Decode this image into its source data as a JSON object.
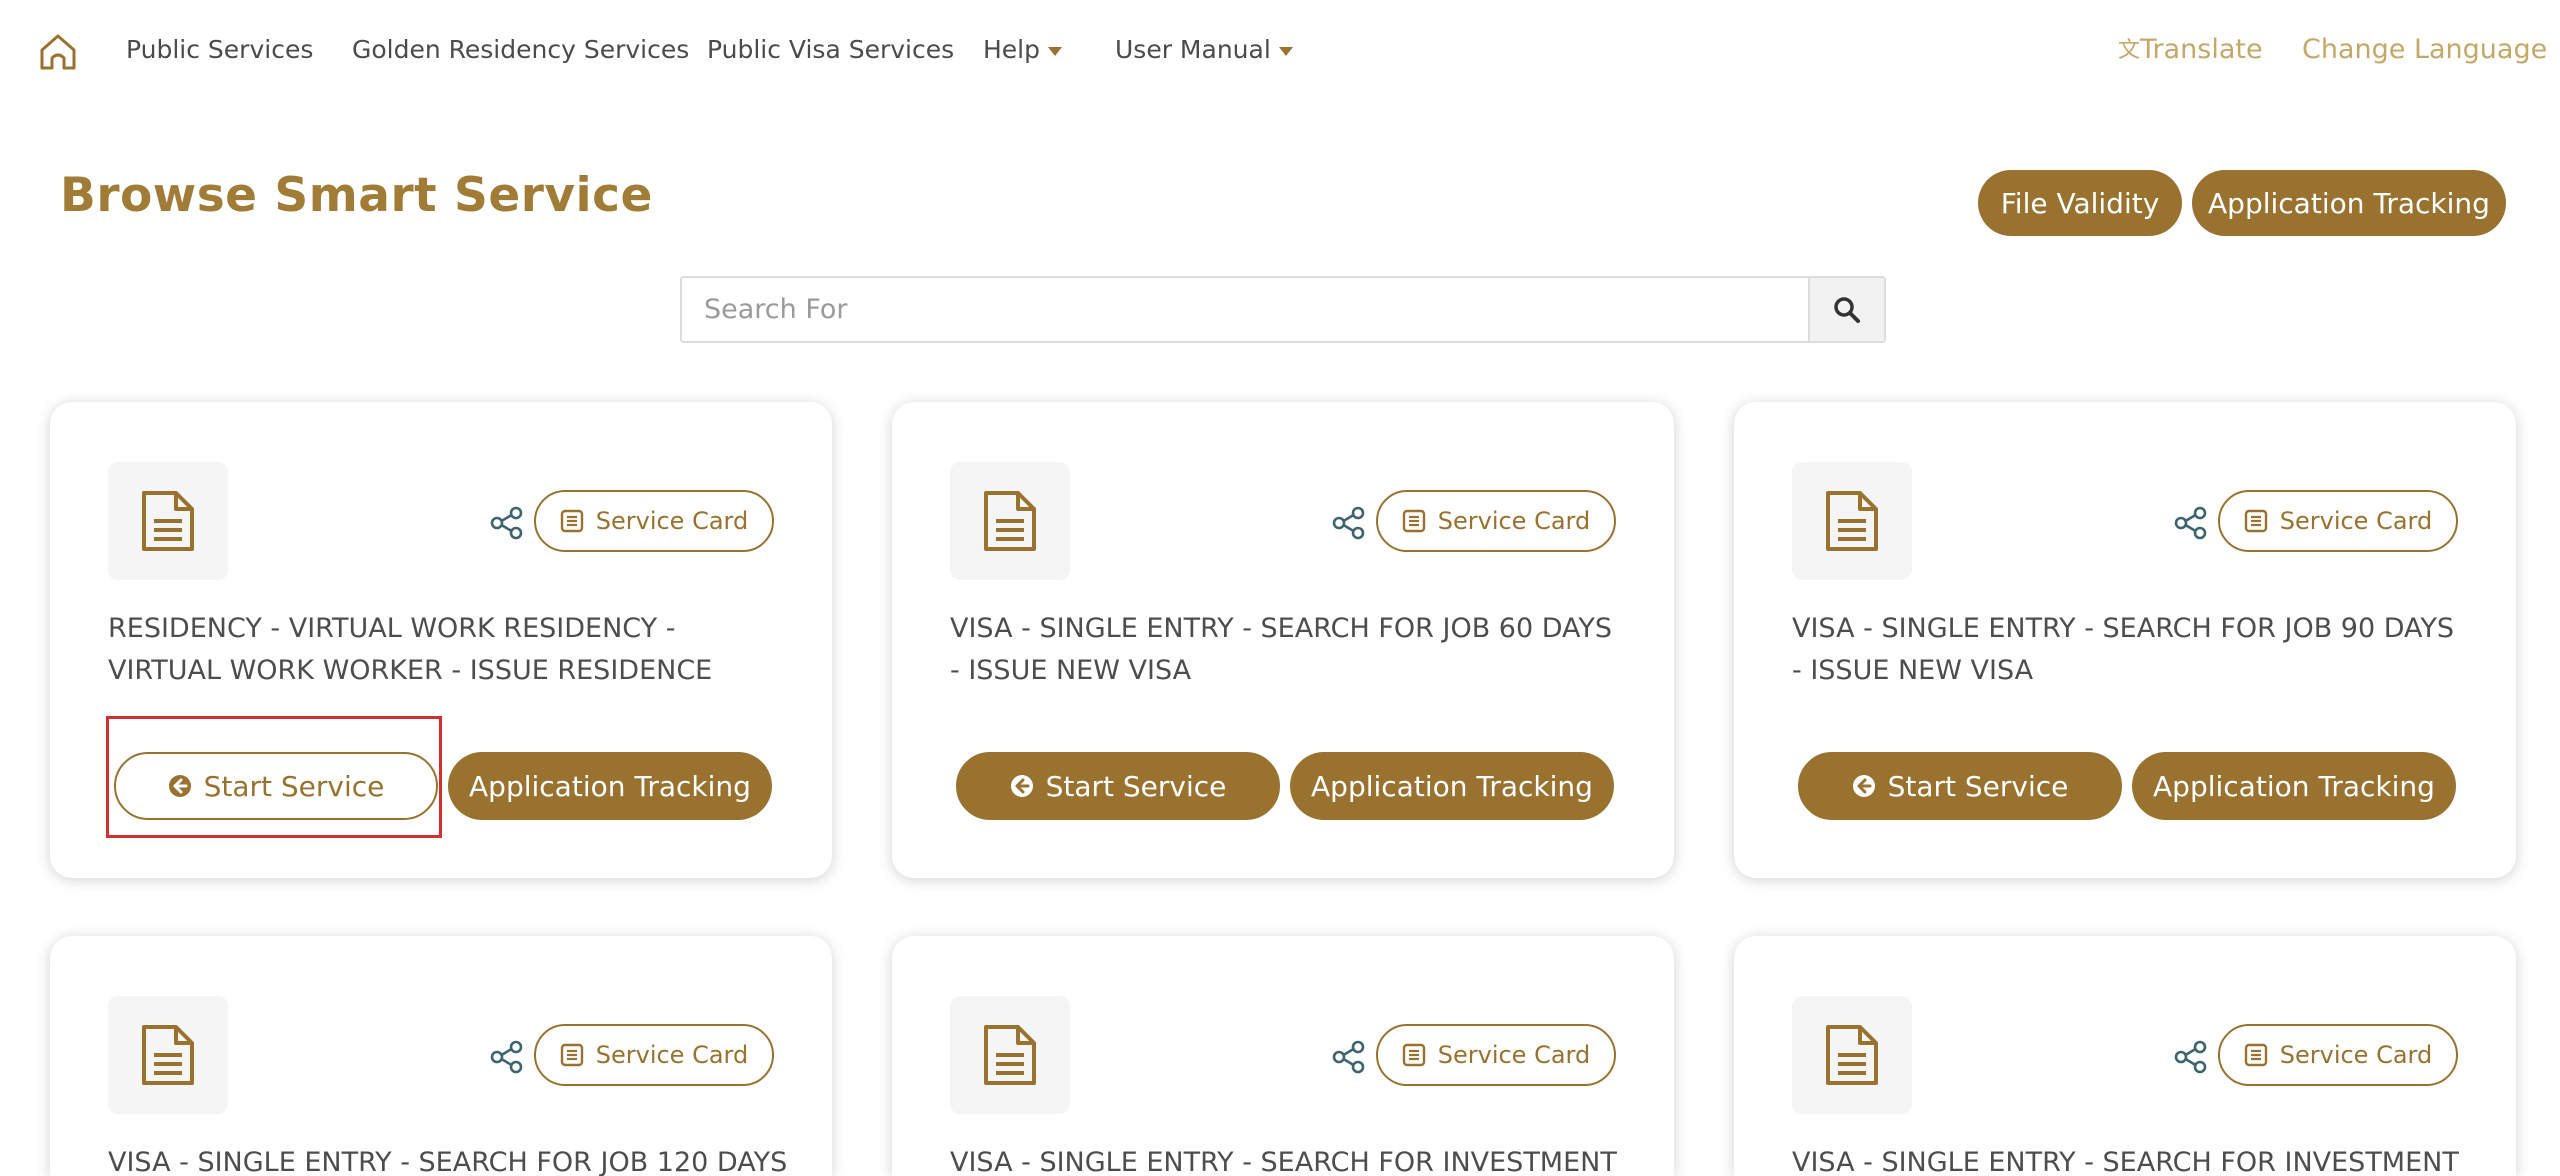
{
  "nav": {
    "items": [
      "Public Services",
      "Golden Residency Services",
      "Public Visa Services",
      "Help",
      "User Manual"
    ],
    "translate": "Translate",
    "change_language": "Change Language"
  },
  "header": {
    "title": "Browse Smart Service",
    "file_validity": "File Validity",
    "application_tracking": "Application Tracking"
  },
  "search": {
    "placeholder": "Search For"
  },
  "card_labels": {
    "service_card": "Service Card",
    "start_service": "Start Service",
    "application_tracking": "Application Tracking"
  },
  "cards": [
    {
      "title": "RESIDENCY - VIRTUAL WORK RESIDENCY - VIRTUAL WORK WORKER - ISSUE RESIDENCE"
    },
    {
      "title": "VISA - SINGLE ENTRY - SEARCH FOR JOB 60 DAYS - ISSUE NEW VISA"
    },
    {
      "title": "VISA - SINGLE ENTRY - SEARCH FOR JOB 90 DAYS - ISSUE NEW VISA"
    },
    {
      "title": "VISA - SINGLE ENTRY - SEARCH FOR JOB 120 DAYS -"
    },
    {
      "title": "VISA - SINGLE ENTRY - SEARCH FOR INVESTMENT"
    },
    {
      "title": "VISA - SINGLE ENTRY - SEARCH FOR INVESTMENT"
    }
  ],
  "colors": {
    "brand": "#9a7230",
    "title": "#a17c37",
    "link_light": "#c4a869",
    "highlight": "#d32f2f"
  }
}
